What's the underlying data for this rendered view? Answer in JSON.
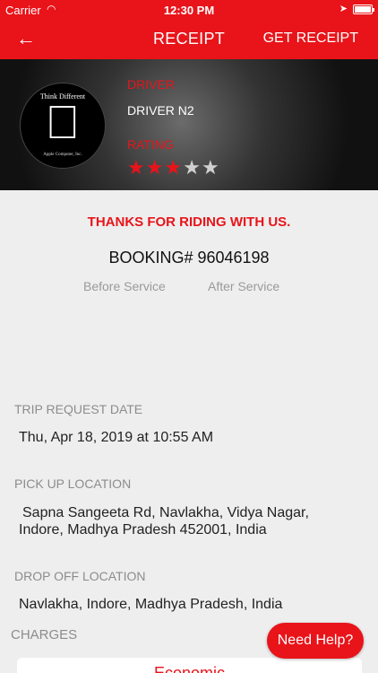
{
  "status_bar": {
    "carrier": "Carrier",
    "time": "12:30 PM"
  },
  "nav": {
    "back_icon": "arrow-left-icon",
    "title": "RECEIPT",
    "get_receipt": "GET RECEIPT"
  },
  "driver": {
    "avatar_tagline": "Think Different",
    "avatar_company": "Apple Computer, Inc.",
    "label": "DRIVER",
    "name": "DRIVER  N2",
    "rating_label": "RATING",
    "rating": 3,
    "rating_max": 5
  },
  "receipt": {
    "thanks": "THANKS FOR RIDING WITH US.",
    "booking": "BOOKING# 96046198",
    "tabs": {
      "before": "Before Service",
      "after": "After Service"
    }
  },
  "trip": {
    "request_label": "TRIP REQUEST DATE",
    "request_date": "Thu, Apr 18, 2019 at 10:55 AM",
    "pickup_label": "PICK UP LOCATION",
    "pickup_line1": "Sapna Sangeeta Rd,  Navlakha,  Vidya Nagar,",
    "pickup_line2": "Indore,  Madhya Pradesh 452001,  India",
    "dropoff_label": "DROP OFF LOCATION",
    "dropoff": "Navlakha, Indore, Madhya Pradesh, India"
  },
  "charges": {
    "label": "CHARGES",
    "card_title": "Economic"
  },
  "help_button": "Need Help?",
  "colors": {
    "accent": "#e8141a",
    "background": "#eeeeee"
  }
}
